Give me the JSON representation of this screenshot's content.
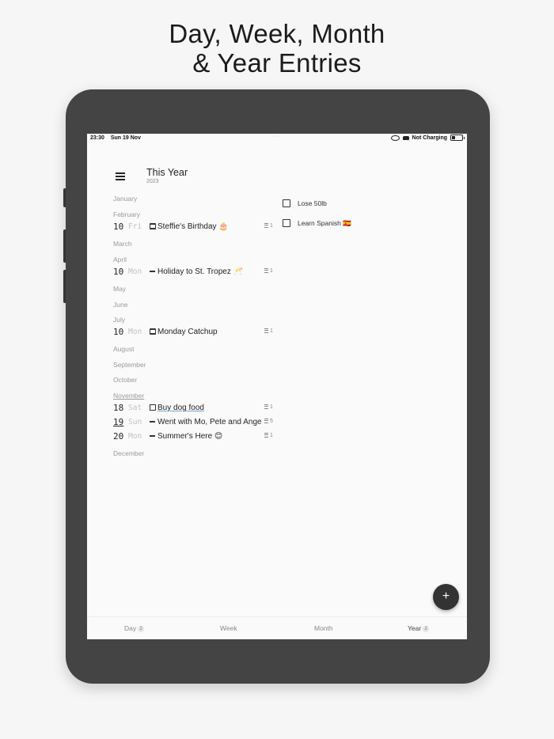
{
  "headline": {
    "line1": "Day, Week, Month",
    "line2": "& Year Entries"
  },
  "status_bar": {
    "time": "23:30",
    "date": "Sun 19 Nov",
    "dots": "···",
    "charging": "Not Charging"
  },
  "header": {
    "title": "This Year",
    "year": "2023"
  },
  "months": [
    "January",
    "February",
    "March",
    "April",
    "May",
    "June",
    "July",
    "August",
    "September",
    "October",
    "November",
    "December"
  ],
  "entries": [
    {
      "day": "10",
      "weekday": "Fri",
      "type": "calendar-icon",
      "text": "Steffie's Birthday 🎂",
      "count": "1"
    },
    {
      "day": "10",
      "weekday": "Mon",
      "type": "dash-icon",
      "text": "Holiday to St. Tropez 🥂",
      "count": "1"
    },
    {
      "day": "10",
      "weekday": "Mon",
      "type": "calendar-icon",
      "text": "Monday Catchup",
      "count": "1"
    },
    {
      "day": "18",
      "weekday": "Sat",
      "type": "checkbox-icon",
      "text": "Buy dog food",
      "count": "1"
    },
    {
      "day": "19",
      "weekday": "Sun",
      "type": "dash-icon",
      "text": "Went with Mo, Pete and Ange",
      "count": "5"
    },
    {
      "day": "20",
      "weekday": "Mon",
      "type": "dash-icon",
      "text": "Summer's Here 😊",
      "count": "1"
    }
  ],
  "goals": [
    {
      "text": "Lose 50lb"
    },
    {
      "text": "Learn Spanish 🇪🇸"
    }
  ],
  "fab": {
    "label": "+"
  },
  "tabs": [
    {
      "label": "Day",
      "badge": "2"
    },
    {
      "label": "Week"
    },
    {
      "label": "Month"
    },
    {
      "label": "Year",
      "badge": "2"
    }
  ]
}
